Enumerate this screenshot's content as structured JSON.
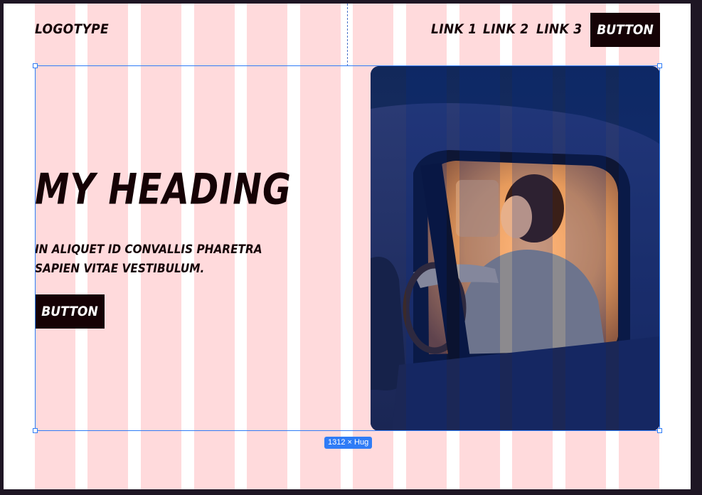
{
  "nav": {
    "logo": "LOGOTYPE",
    "links": [
      "LINK 1",
      "LINK 2",
      "LINK 3"
    ],
    "button_label": "BUTTON"
  },
  "hero": {
    "heading": "MY HEADING",
    "subtext": "IN ALIQUET ID CONVALLIS PHARETRA SAPIEN VITAE VESTIBULUM.",
    "button_label": "BUTTON",
    "image_alt": "Woman sitting in a car at night, viewed through the side window"
  },
  "selection": {
    "size_label": "1312 × Hug"
  },
  "colors": {
    "canvas_bg": "#ffffff",
    "layout_grid_column": "#ffdadc",
    "text_primary": "#150205",
    "button_bg": "#150205",
    "selection_accent": "#2f7cf6",
    "editor_bg": "#1e1624"
  }
}
